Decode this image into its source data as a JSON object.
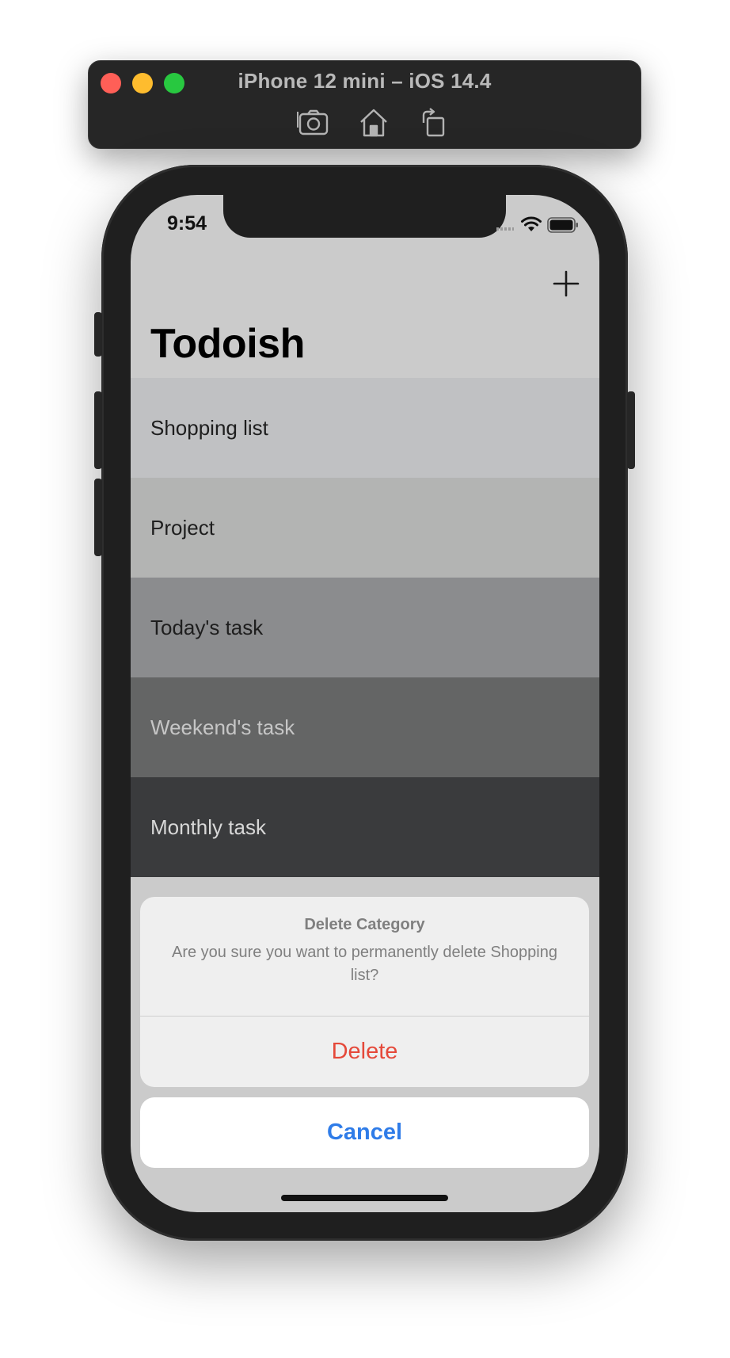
{
  "simulator": {
    "title": "iPhone 12 mini – iOS 14.4",
    "toolbar": [
      {
        "icon": "screenshot-icon"
      },
      {
        "icon": "home-icon"
      },
      {
        "icon": "rotate-icon"
      }
    ]
  },
  "status_bar": {
    "time": "9:54"
  },
  "nav": {
    "title": "Todoish",
    "add_icon": "plus-icon"
  },
  "categories": [
    {
      "name": "Shopping list",
      "bg": "#c0c1c3",
      "fg": "#1e1e1e"
    },
    {
      "name": "Project",
      "bg": "#b3b4b3",
      "fg": "#1e1e1e"
    },
    {
      "name": "Today's task",
      "bg": "#8b8c8e",
      "fg": "#1e1e1e"
    },
    {
      "name": "Weekend's task",
      "bg": "#646565",
      "fg": "#c6c6c6"
    },
    {
      "name": "Monthly task",
      "bg": "#3a3b3d",
      "fg": "#d8d8d8"
    }
  ],
  "action_sheet": {
    "title": "Delete Category",
    "message": "Are you sure you want to permanently delete Shopping list?",
    "delete_label": "Delete",
    "cancel_label": "Cancel"
  },
  "colors": {
    "destructive": "#e5493a",
    "accent": "#2f7ce8"
  }
}
